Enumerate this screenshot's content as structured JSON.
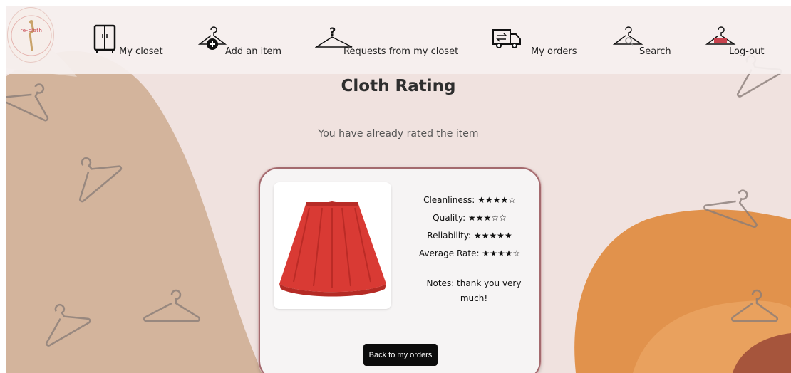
{
  "nav": {
    "items": [
      {
        "label": "My closet",
        "icon": "closet-icon"
      },
      {
        "label": "Add an item",
        "icon": "hanger-add-icon"
      },
      {
        "label": "Requests from my closet",
        "icon": "hanger-question-icon"
      },
      {
        "label": "My orders",
        "icon": "truck-icon"
      },
      {
        "label": "Search",
        "icon": "hanger-search-icon"
      },
      {
        "label": "Log-out",
        "icon": "hanger-exit-icon"
      }
    ]
  },
  "logo": {
    "text": "re-cloth"
  },
  "page": {
    "title": "Cloth Rating",
    "status": "You have already rated the item"
  },
  "rating": {
    "item_icon": "red-skirt-image",
    "cleanliness": "Cleanliness: ★★★★☆",
    "quality": "Quality: ★★★☆☆",
    "reliability": "Reliability: ★★★★★",
    "average": "Average Rate: ★★★★☆",
    "notes": "Notes: thank you very much!"
  },
  "actions": {
    "back_label": "Back to my orders"
  },
  "colors": {
    "background": "#f0e2df",
    "left_blob": "#d4b39a",
    "right_blob": "#e0904a",
    "accent_dark": "#a4533a",
    "button": "#0c0c0c"
  }
}
